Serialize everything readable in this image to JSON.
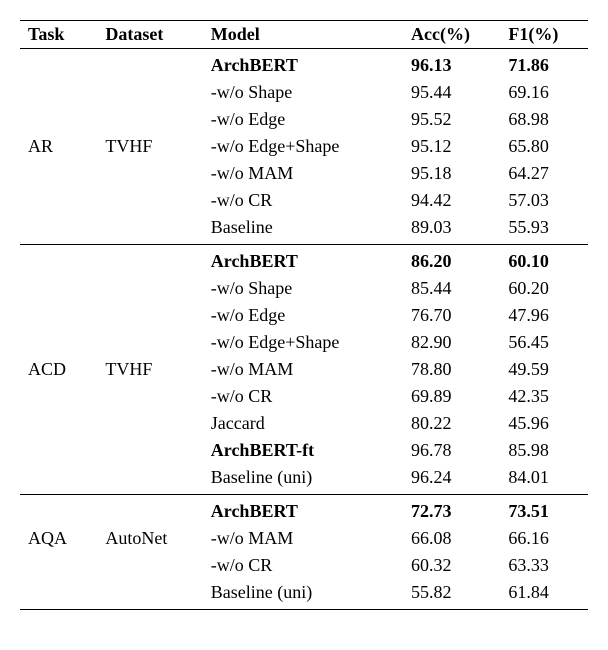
{
  "headers": {
    "task": "Task",
    "dataset": "Dataset",
    "model": "Model",
    "acc": "Acc(%)",
    "f1": "F1(%)"
  },
  "chart_data": {
    "type": "table",
    "columns": [
      "Task",
      "Dataset",
      "Model",
      "Acc(%)",
      "F1(%)"
    ],
    "sections": [
      {
        "task": "AR",
        "dataset": "TVHF",
        "rows": [
          {
            "model": "ArchBERT",
            "acc": "96.13",
            "f1": "71.86",
            "bold": true
          },
          {
            "model": "-w/o Shape",
            "acc": "95.44",
            "f1": "69.16"
          },
          {
            "model": "-w/o Edge",
            "acc": "95.52",
            "f1": "68.98"
          },
          {
            "model": "-w/o Edge+Shape",
            "acc": "95.12",
            "f1": "65.80"
          },
          {
            "model": "-w/o MAM",
            "acc": "95.18",
            "f1": "64.27"
          },
          {
            "model": "-w/o CR",
            "acc": "94.42",
            "f1": "57.03"
          },
          {
            "model": "Baseline",
            "acc": "89.03",
            "f1": "55.93"
          }
        ]
      },
      {
        "task": "ACD",
        "dataset": "TVHF",
        "rows": [
          {
            "model": "ArchBERT",
            "acc": "86.20",
            "f1": "60.10",
            "bold": true
          },
          {
            "model": "-w/o Shape",
            "acc": "85.44",
            "f1": "60.20"
          },
          {
            "model": "-w/o Edge",
            "acc": "76.70",
            "f1": "47.96"
          },
          {
            "model": "-w/o Edge+Shape",
            "acc": "82.90",
            "f1": "56.45"
          },
          {
            "model": "-w/o MAM",
            "acc": "78.80",
            "f1": "49.59"
          },
          {
            "model": "-w/o CR",
            "acc": "69.89",
            "f1": "42.35"
          },
          {
            "model": "Jaccard",
            "acc": "80.22",
            "f1": "45.96"
          },
          {
            "model": "ArchBERT-ft",
            "acc": "96.78",
            "f1": "85.98",
            "bold_model": true
          },
          {
            "model": "Baseline (uni)",
            "acc": "96.24",
            "f1": "84.01"
          }
        ]
      },
      {
        "task": "AQA",
        "dataset": "AutoNet",
        "rows": [
          {
            "model": "ArchBERT",
            "acc": "72.73",
            "f1": "73.51",
            "bold": true
          },
          {
            "model": "-w/o MAM",
            "acc": "66.08",
            "f1": "66.16"
          },
          {
            "model": "-w/o CR",
            "acc": "60.32",
            "f1": "63.33"
          },
          {
            "model": "Baseline (uni)",
            "acc": "55.82",
            "f1": "61.84"
          }
        ]
      }
    ]
  }
}
